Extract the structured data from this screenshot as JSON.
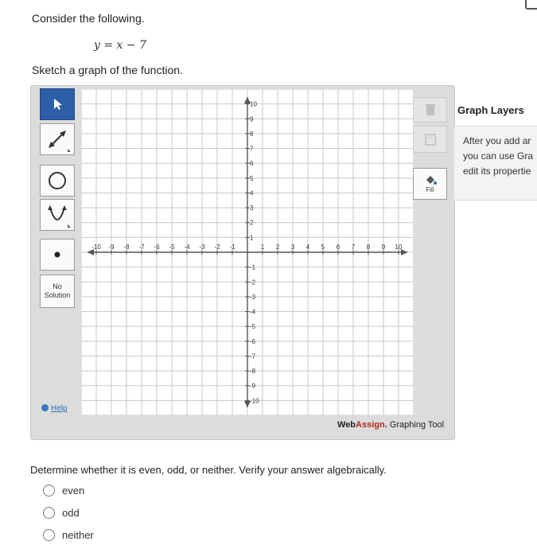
{
  "question": {
    "prompt": "Consider the following.",
    "equation": "y = x − 7",
    "instruction": "Sketch a graph of the function."
  },
  "graph_tool": {
    "tools": [
      {
        "name": "pointer",
        "icon": "arrow-pointer-icon",
        "active": true
      },
      {
        "name": "line",
        "icon": "line-segment-icon",
        "active": false
      },
      {
        "name": "circle",
        "icon": "circle-icon",
        "active": false
      },
      {
        "name": "parabola",
        "icon": "parabola-icon",
        "active": false
      },
      {
        "name": "point",
        "icon": "point-icon",
        "active": false
      }
    ],
    "no_solution_label": "No Solution",
    "help_label": "Help",
    "right_tools": [
      {
        "name": "delete",
        "icon": "trash-icon",
        "enabled": false
      },
      {
        "name": "layers",
        "icon": "layers-icon",
        "enabled": false
      },
      {
        "name": "fill",
        "icon": "fill-bucket-icon",
        "label": "Fill",
        "enabled": true
      }
    ],
    "axis": {
      "x_ticks": [
        "-10",
        "-9",
        "-8",
        "-7",
        "-6",
        "-5",
        "-4",
        "-3",
        "-2",
        "-1",
        "1",
        "2",
        "3",
        "4",
        "5",
        "6",
        "7",
        "8",
        "9",
        "10"
      ],
      "y_ticks_pos": [
        "10",
        "9",
        "8",
        "7",
        "6",
        "5",
        "4",
        "3",
        "2",
        "1"
      ],
      "y_ticks_neg": [
        "-1",
        "-2",
        "-3",
        "-4",
        "-5",
        "-6",
        "-7",
        "-8",
        "-9",
        "-10"
      ]
    },
    "brand": {
      "web": "Web",
      "assign": "Assign.",
      "suffix": " Graphing Tool"
    },
    "colors": {
      "active_tool": "#2c5fa8",
      "grid": "#c9c9c9",
      "axis": "#555555",
      "brand_accent": "#b5271e"
    }
  },
  "graph_layers": {
    "title": "Graph Layers",
    "body_lines": [
      "After you add ar",
      "you can use Gra",
      "edit its propertie"
    ]
  },
  "followup": {
    "question": "Determine whether it is even, odd, or neither. Verify your answer algebraically.",
    "options": [
      "even",
      "odd",
      "neither"
    ]
  }
}
